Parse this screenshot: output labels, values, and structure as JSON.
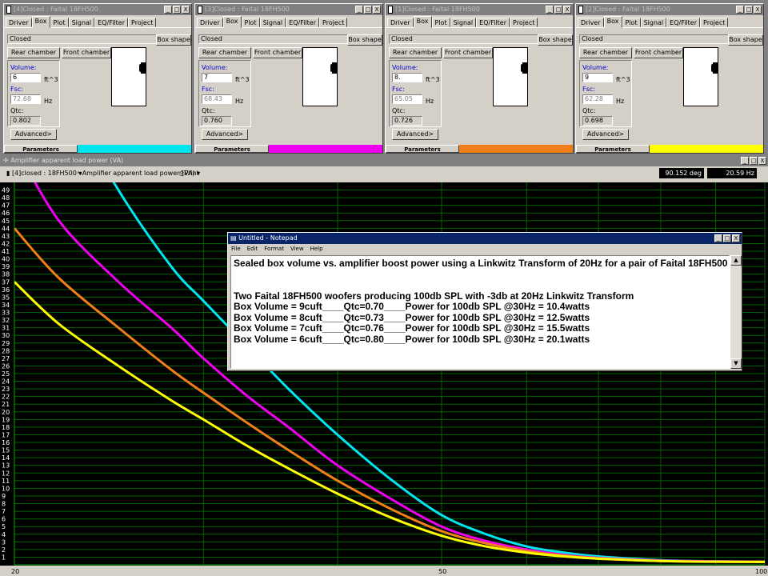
{
  "panels": [
    {
      "title": "[4]Closed : Faital 18FH500",
      "status": "Closed",
      "volume": "6",
      "fsc": "72.68",
      "qtc": "0.802",
      "color": "#00e5ee"
    },
    {
      "title": "[3]Closed : Faital 18FH500",
      "status": "Closed",
      "volume": "7",
      "fsc": "68.43",
      "qtc": "0.760",
      "color": "#ee00ee"
    },
    {
      "title": "[1]Closed : Faital 18FH500",
      "status": "Closed",
      "volume": "8.",
      "fsc": "65.05",
      "qtc": "0.726",
      "color": "#f07f1a"
    },
    {
      "title": "[2]Closed : Faital 18FH500",
      "status": "Closed",
      "volume": "9",
      "fsc": "62.28",
      "qtc": "0.698",
      "color": "#ffff00"
    }
  ],
  "panel_labels": {
    "tabs": [
      "Driver",
      "Box",
      "Plot",
      "Signal",
      "EQ/Filter",
      "Project"
    ],
    "box_shape": "Box shape",
    "rear": "Rear chamber",
    "front": "Front chamber",
    "volume": "Volume:",
    "volume_unit": "ft^3",
    "fsc": "Fsc:",
    "fsc_unit": "Hz",
    "qtc": "Qtc:",
    "advanced": "Advanced>",
    "parameters": "Parameters",
    "min": "_",
    "max": "□",
    "close": "X"
  },
  "graph": {
    "title": "Amplifier apparent load power (VA)",
    "source_select": "[4]closed : 18FH500",
    "plot_select": "Amplifier apparent load power (VA)",
    "print": "Print",
    "readout_deg": "90.152 deg",
    "readout_hz": "20.59 Hz",
    "x_label_20": "20",
    "x_label_50": "50",
    "x_label_100": "100"
  },
  "chart_data": {
    "type": "line",
    "title": "Amplifier apparent load power (VA)",
    "xlabel": "",
    "ylabel": "",
    "x_scale": "log",
    "xlim": [
      20,
      100
    ],
    "ylim": [
      0,
      50
    ],
    "y_ticks": [
      1,
      2,
      3,
      4,
      5,
      6,
      7,
      8,
      9,
      10,
      11,
      12,
      13,
      14,
      15,
      16,
      17,
      18,
      19,
      20,
      21,
      22,
      23,
      24,
      25,
      26,
      27,
      28,
      29,
      30,
      31,
      32,
      33,
      34,
      35,
      36,
      37,
      38,
      39,
      40,
      41,
      42,
      43,
      44,
      45,
      46,
      47,
      48,
      49
    ],
    "x_tick_labels": [
      "20",
      "50",
      "100"
    ],
    "grid": true,
    "series": [
      {
        "color": "#00e5ee",
        "x": [
          20,
          22,
          25,
          28,
          30,
          33,
          36,
          40,
          45,
          50,
          55,
          60,
          65,
          70,
          80,
          90,
          100
        ],
        "y": [
          80,
          63,
          49,
          39,
          34.5,
          28.5,
          23,
          17,
          11,
          6.5,
          4.0,
          2.4,
          1.6,
          1.1,
          0.6,
          0.45,
          0.4
        ]
      },
      {
        "color": "#ee00ee",
        "x": [
          20,
          22,
          25,
          28,
          30,
          33,
          36,
          40,
          45,
          50,
          55,
          60,
          65,
          70,
          80,
          90,
          100
        ],
        "y": [
          55,
          45,
          37,
          31,
          27,
          22,
          18,
          13,
          8.5,
          5.0,
          3.1,
          2.0,
          1.3,
          0.9,
          0.55,
          0.45,
          0.4
        ]
      },
      {
        "color": "#f07f1a",
        "x": [
          20,
          22,
          25,
          28,
          30,
          33,
          36,
          40,
          45,
          50,
          55,
          60,
          65,
          70,
          80,
          90,
          100
        ],
        "y": [
          44,
          37.5,
          31,
          25.5,
          22.5,
          18.5,
          15,
          11,
          7.2,
          4.4,
          2.8,
          1.8,
          1.2,
          0.85,
          0.5,
          0.4,
          0.38
        ]
      },
      {
        "color": "#ffff00",
        "x": [
          20,
          22,
          25,
          28,
          30,
          33,
          36,
          40,
          45,
          50,
          55,
          60,
          65,
          70,
          80,
          90,
          100
        ],
        "y": [
          37,
          31.5,
          26,
          21.5,
          19,
          15.5,
          12.6,
          9.3,
          6.1,
          3.8,
          2.4,
          1.6,
          1.1,
          0.8,
          0.5,
          0.4,
          0.38
        ]
      }
    ]
  },
  "notepad": {
    "title": "Untitled - Notepad",
    "menu": [
      "File",
      "Edit",
      "Format",
      "View",
      "Help"
    ],
    "lines": [
      "Sealed box volume vs. amplifier boost power using a Linkwitz Transform of 20Hz for a pair of Faital 18FH500 woofers",
      "",
      "",
      "Two Faital 18FH500 woofers producing 100db SPL with -3db at 20Hz Linkwitz Transform",
      "Box Volume = 9cuft____Qtc=0.70____Power for 100db SPL @30Hz = 10.4watts",
      "Box Volume = 8cuft____Qtc=0.73____Power for 100db SPL @30Hz = 12.5watts",
      "Box Volume = 7cuft____Qtc=0.76____Power for 100db SPL @30Hz = 15.5watts",
      "Box Volume = 6cuft____Qtc=0.80____Power for 100db SPL @30Hz = 20.1watts"
    ]
  }
}
